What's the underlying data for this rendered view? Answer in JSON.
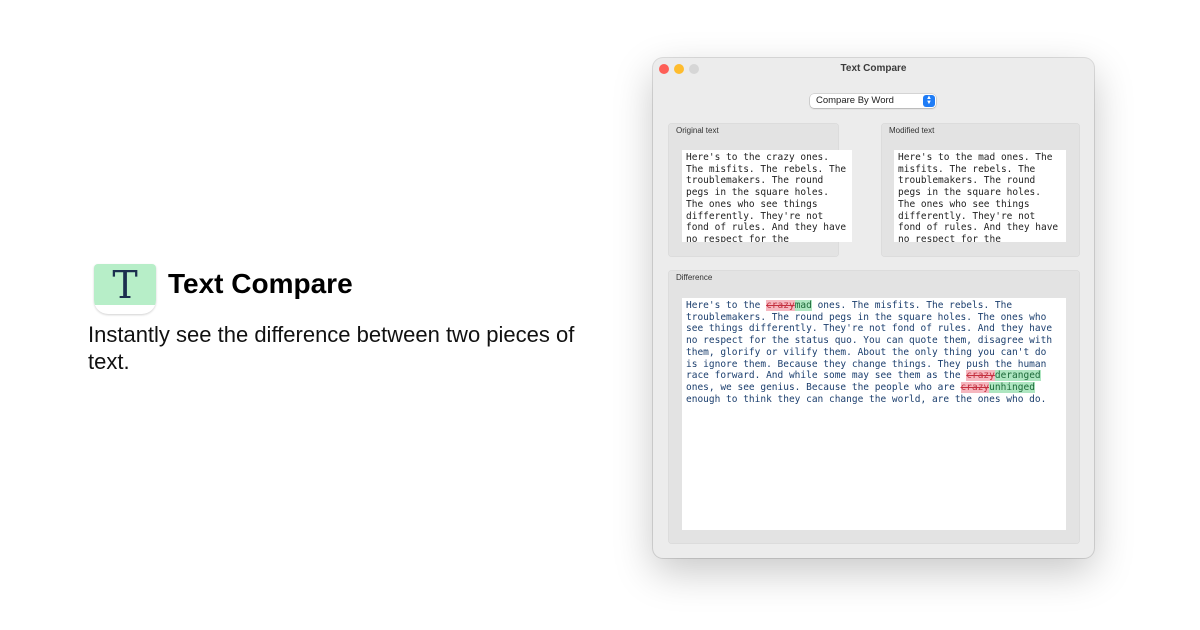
{
  "promo": {
    "app_name": "Text Compare",
    "icon_letter": "T",
    "tagline": "Instantly see the difference between two pieces of text."
  },
  "window": {
    "title": "Text Compare",
    "mode_select": {
      "value": "Compare By Word"
    },
    "original": {
      "label": "Original text",
      "text": "Here's to the crazy ones. The misfits. The rebels. The troublemakers. The round pegs in the square holes. The ones who see things differently. They're not fond of rules. And they have no respect for the"
    },
    "modified": {
      "label": "Modified text",
      "text": "Here's to the mad ones. The misfits. The rebels. The troublemakers. The round pegs in the square holes. The ones who see things differently. They're not fond of rules. And they have no respect for the"
    },
    "difference": {
      "label": "Difference",
      "segments": [
        "Here's to the ",
        "crazy",
        "mad",
        " ones. The misfits. The rebels. The troublemakers. The round pegs in the square holes. The ones who see things differently. They're not fond of rules. And they have no respect for the status quo. You can quote them, disagree with them, glorify or vilify them. About the only thing you can't do is ignore them. Because they change things. They push the human race forward. And while some may see them as the ",
        "crazy",
        "deranged",
        " ones, we see genius. Because the people who are ",
        "crazy",
        "unhinged",
        " enough to think they can change the world, are the ones who do."
      ]
    }
  },
  "colors": {
    "deleted_bg": "#f6b7bf",
    "inserted_bg": "#aee6c1",
    "icon_bg": "#b7eec8",
    "accent": "#1f7cf6"
  }
}
